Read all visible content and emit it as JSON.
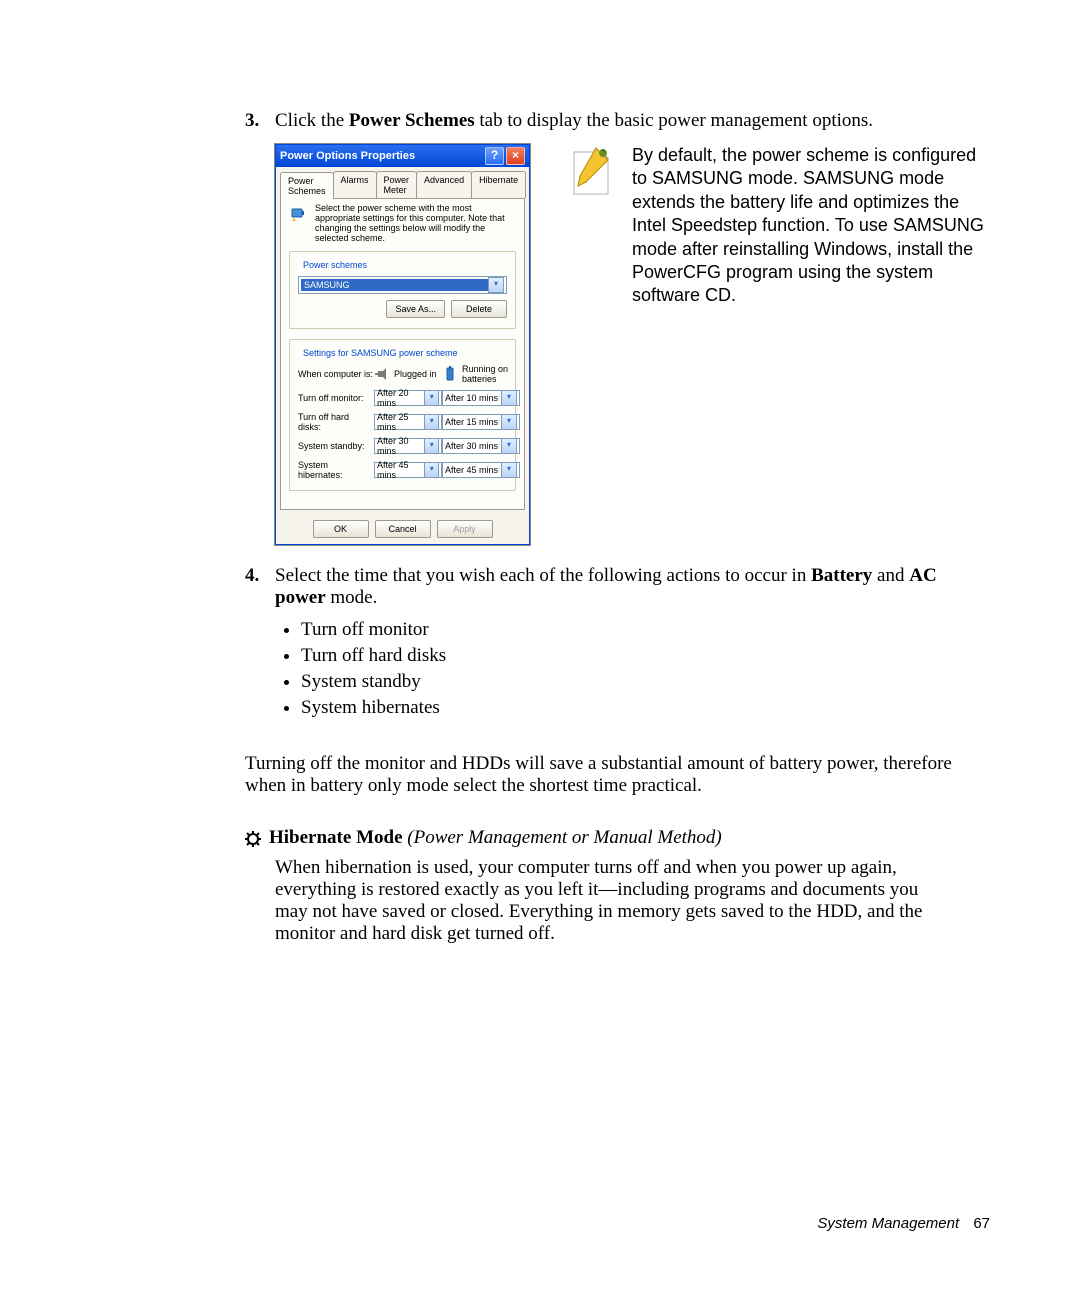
{
  "step3": {
    "num": "3.",
    "pre": "Click the ",
    "bold": "Power Schemes",
    "post": " tab to display the basic power management options."
  },
  "dialog": {
    "title": "Power Options Properties",
    "help": "?",
    "close": "×",
    "tabs": [
      "Power Schemes",
      "Alarms",
      "Power Meter",
      "Advanced",
      "Hibernate"
    ],
    "infotext": "Select the power scheme with the most appropriate settings for this computer. Note that changing the settings below will modify the selected scheme.",
    "fieldset1_label": "Power schemes",
    "scheme_selected": "SAMSUNG",
    "btn_saveas": "Save As...",
    "btn_delete": "Delete",
    "fieldset2_label": "Settings for SAMSUNG power scheme",
    "col_label": "When computer is:",
    "col_plugged": "Plugged in",
    "col_battery_top": "Running on",
    "col_battery_bot": "batteries",
    "rows": {
      "monitor_label": "Turn off monitor:",
      "monitor_plug": "After 20 mins",
      "monitor_batt": "After 10 mins",
      "disks_label": "Turn off hard disks:",
      "disks_plug": "After 25 mins",
      "disks_batt": "After 15 mins",
      "standby_label": "System standby:",
      "standby_plug": "After 30 mins",
      "standby_batt": "After 30 mins",
      "hib_label": "System hibernates:",
      "hib_plug": "After 45 mins",
      "hib_batt": "After 45 mins"
    },
    "ok": "OK",
    "cancel": "Cancel",
    "apply": "Apply"
  },
  "tip": "By default, the power scheme is configured to SAMSUNG mode. SAMSUNG mode extends the battery life and optimizes the Intel Speedstep function. To use SAMSUNG mode after reinstalling Windows, install the PowerCFG program using the system software CD.",
  "step4": {
    "num": "4.",
    "pre": "Select the time that you wish each of the following actions to occur in ",
    "bold1": "Battery",
    "mid": " and ",
    "bold2": "AC power",
    "post": " mode.",
    "bullets": [
      "Turn off monitor",
      "Turn off hard disks",
      "System standby",
      "System hibernates"
    ]
  },
  "para": "Turning off the monitor and HDDs will save a substantial amount of battery power, therefore when in battery only mode select the shortest time practical.",
  "hmode": {
    "title": "Hibernate Mode",
    "sub": " (Power Management or Manual Method)",
    "body": "When hibernation is used, your computer turns off and when you power up again, everything is restored exactly as you left it—including programs and documents you may not have saved or closed. Everything in memory gets saved to the HDD, and the monitor and hard disk get turned off."
  },
  "footer": {
    "section": "System Management",
    "page": "67"
  }
}
